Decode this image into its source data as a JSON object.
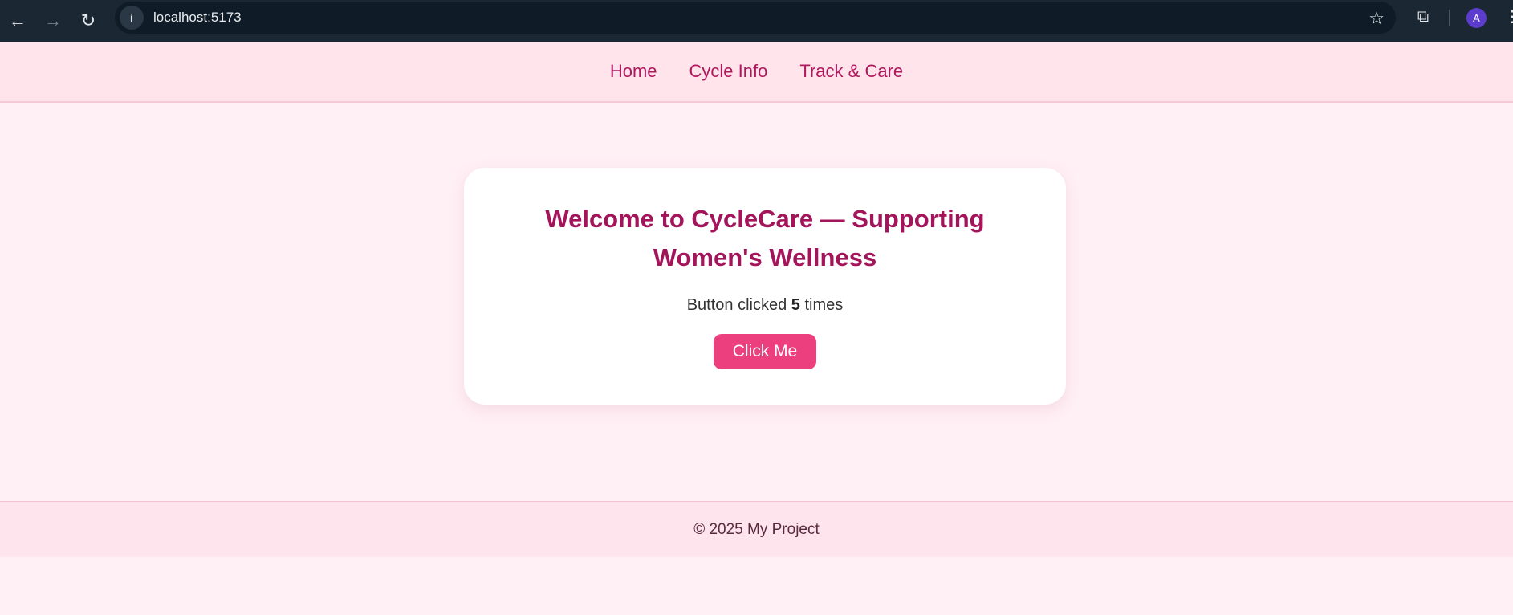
{
  "browser": {
    "url": "localhost:5173",
    "icons": {
      "back": "arrow-left",
      "forward": "arrow-right",
      "reload": "reload",
      "info": "info",
      "bookmark": "star",
      "extensions": "puzzle",
      "menu": "vertical-dots"
    },
    "avatar_initial": "A",
    "avatar_color": "#5b3ccc"
  },
  "nav": {
    "items": [
      {
        "label": "Home"
      },
      {
        "label": "Cycle Info"
      },
      {
        "label": "Track & Care"
      }
    ],
    "link_color": "#b0175c"
  },
  "card": {
    "title": "Welcome to CycleCare — Supporting Women's Wellness",
    "counter_prefix": "Button clicked",
    "counter_value": "5",
    "counter_suffix": "times",
    "button_label": "Click Me",
    "button_color": "#ec3f7d",
    "title_color": "#a3145a"
  },
  "footer": {
    "text": "© 2025 My Project"
  },
  "colors": {
    "page_bg": "#fff0f5",
    "nav_bg": "#ffe4ec",
    "footer_bg": "#fde4ed",
    "chrome_bg": "#1b2733"
  }
}
